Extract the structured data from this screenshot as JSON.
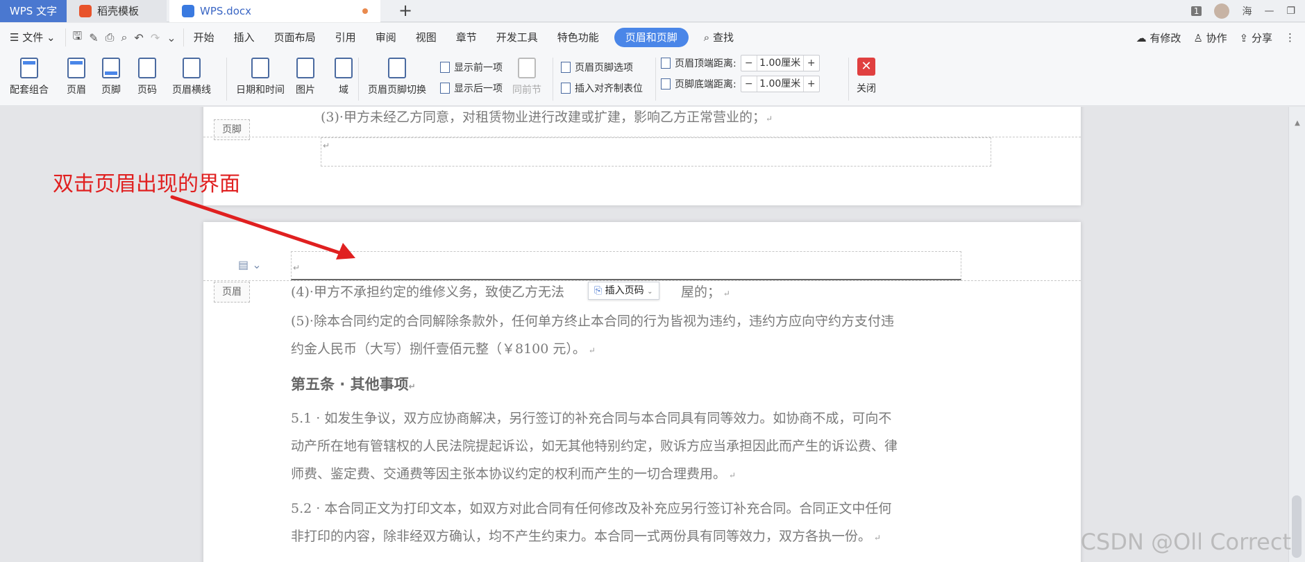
{
  "titlebar": {
    "app_tab": "WPS 文字",
    "tabs": [
      {
        "label": "稻壳模板",
        "icon": "docer-icon"
      },
      {
        "label": "WPS.docx",
        "icon": "word-doc-icon"
      }
    ],
    "page_badge": "1",
    "user_name": "海"
  },
  "menubar": {
    "file": "文件",
    "items": [
      "开始",
      "插入",
      "页面布局",
      "引用",
      "审阅",
      "视图",
      "章节",
      "开发工具",
      "特色功能"
    ],
    "active_item": "页眉和页脚",
    "search": "查找",
    "right": {
      "modified": "有修改",
      "collaborate": "协作",
      "share": "分享"
    }
  },
  "ribbon": {
    "buttons": {
      "combo": "配套组合",
      "header": "页眉",
      "footer": "页脚",
      "page_number": "页码",
      "header_line": "页眉横线",
      "datetime": "日期和时间",
      "picture": "图片",
      "field": "域",
      "switch": "页眉页脚切换",
      "same_prev": "同前节",
      "close": "关闭"
    },
    "show_prev": "显示前一项",
    "show_next": "显示后一项",
    "options": "页眉页脚选项",
    "insert_align_tab": "插入对齐制表位",
    "header_top_label": "页眉顶端距离:",
    "header_top_value": "1.00厘米",
    "footer_bottom_label": "页脚底端距离:",
    "footer_bottom_value": "1.00厘米"
  },
  "document": {
    "footer_tag": "页脚",
    "header_tag": "页眉",
    "page1_line": "(3)·甲方未经乙方同意，对租赁物业进行改建或扩建，影响乙方正常营业的；",
    "insert_page_number": "插入页码",
    "p4_before": "(4)·甲方不承担约定的维修义务，致使乙方无法",
    "p4_after": "屋的；",
    "p5_line1": "(5)·除本合同约定的合同解除条款外，任何单方终止本合同的行为皆视为违约，违约方应向守约方支付违",
    "p5_line2": "约金人民币（大写）捌仟壹佰元整（￥8100 元）。",
    "heading": "第五条 · 其他事项",
    "s51_line1": "5.1 · 如发生争议，双方应协商解决，另行签订的补充合同与本合同具有同等效力。如协商不成，可向不",
    "s51_line2": "动产所在地有管辖权的人民法院提起诉讼，如无其他特别约定，败诉方应当承担因此而产生的诉讼费、律",
    "s51_line3": "师费、鉴定费、交通费等因主张本协议约定的权利而产生的一切合理费用。",
    "s52_line1": "5.2 · 本合同正文为打印文本，如双方对此合同有任何修改及补充应另行签订补充合同。合同正文中任何",
    "s52_line2": "非打印的内容，除非经双方确认，均不产生约束力。本合同一式两份具有同等效力，双方各执一份。"
  },
  "annotation": "双击页眉出现的界面",
  "watermark": "CSDN @Oll Correct",
  "colors": {
    "accent": "#4a86e8",
    "annotation": "#e02020",
    "close": "#e04040"
  }
}
